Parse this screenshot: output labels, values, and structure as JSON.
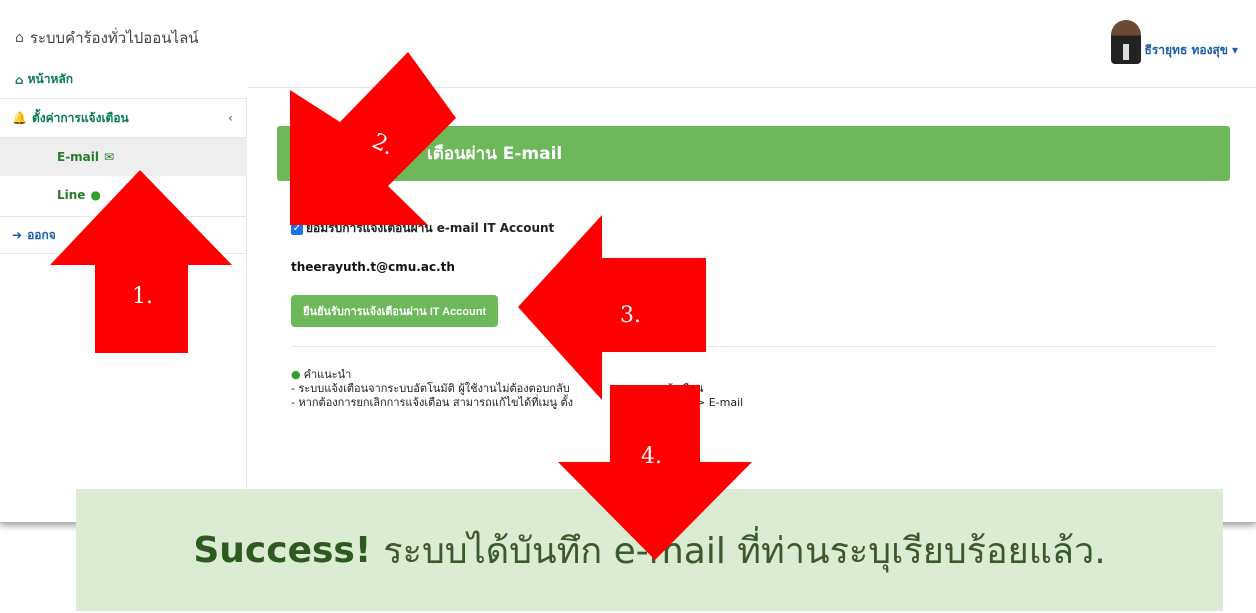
{
  "header": {
    "brand_title": "ระบบคำร้องทั่วไปออนไลน์",
    "home_label": "หน้าหลัก",
    "user_name": "ธีรายุทธ ทองสุข"
  },
  "sidebar": {
    "items": [
      {
        "label": "ตั้งค่าการแจ้งเตือน"
      },
      {
        "label": "E-mail"
      },
      {
        "label": "Line"
      },
      {
        "label": "ออกจ"
      }
    ]
  },
  "main": {
    "panel_title": "เตือนผ่าน E-mail",
    "consent_label": "ยอมรับการแจ้งเตือนผ่าน e-mail IT Account",
    "email": "theerayuth.t@cmu.ac.th",
    "confirm_button": "ยืนยันรับการแจ้งเตือนผ่าน IT Account",
    "tips_title": "คำแนะนำ",
    "tips_line1": "- ระบบแจ้งเตือนจากระบบอัตโนมัติ ผู้ใช้งานไม่ต้องตอบกลับ",
    "tips_line1_tail": "การแจ้งเตือน",
    "tips_line2": "- หากต้องการยกเลิกการแจ้งเตือน สามารถแก้ไขได้ที่เมนู ตั้ง",
    "tips_line2_tail": "-> E-mail"
  },
  "banner": {
    "success_word": "Success!",
    "message": "ระบบได้บันทึก e-mail ที่ท่านระบุเรียบร้อยแล้ว."
  },
  "steps": {
    "step1": "1.",
    "step2": "2.",
    "step3": "3.",
    "step4": "4."
  },
  "colors": {
    "accent_green": "#6cb85a",
    "arrow_red": "#ff0000",
    "banner_bg": "#dcebd3"
  }
}
